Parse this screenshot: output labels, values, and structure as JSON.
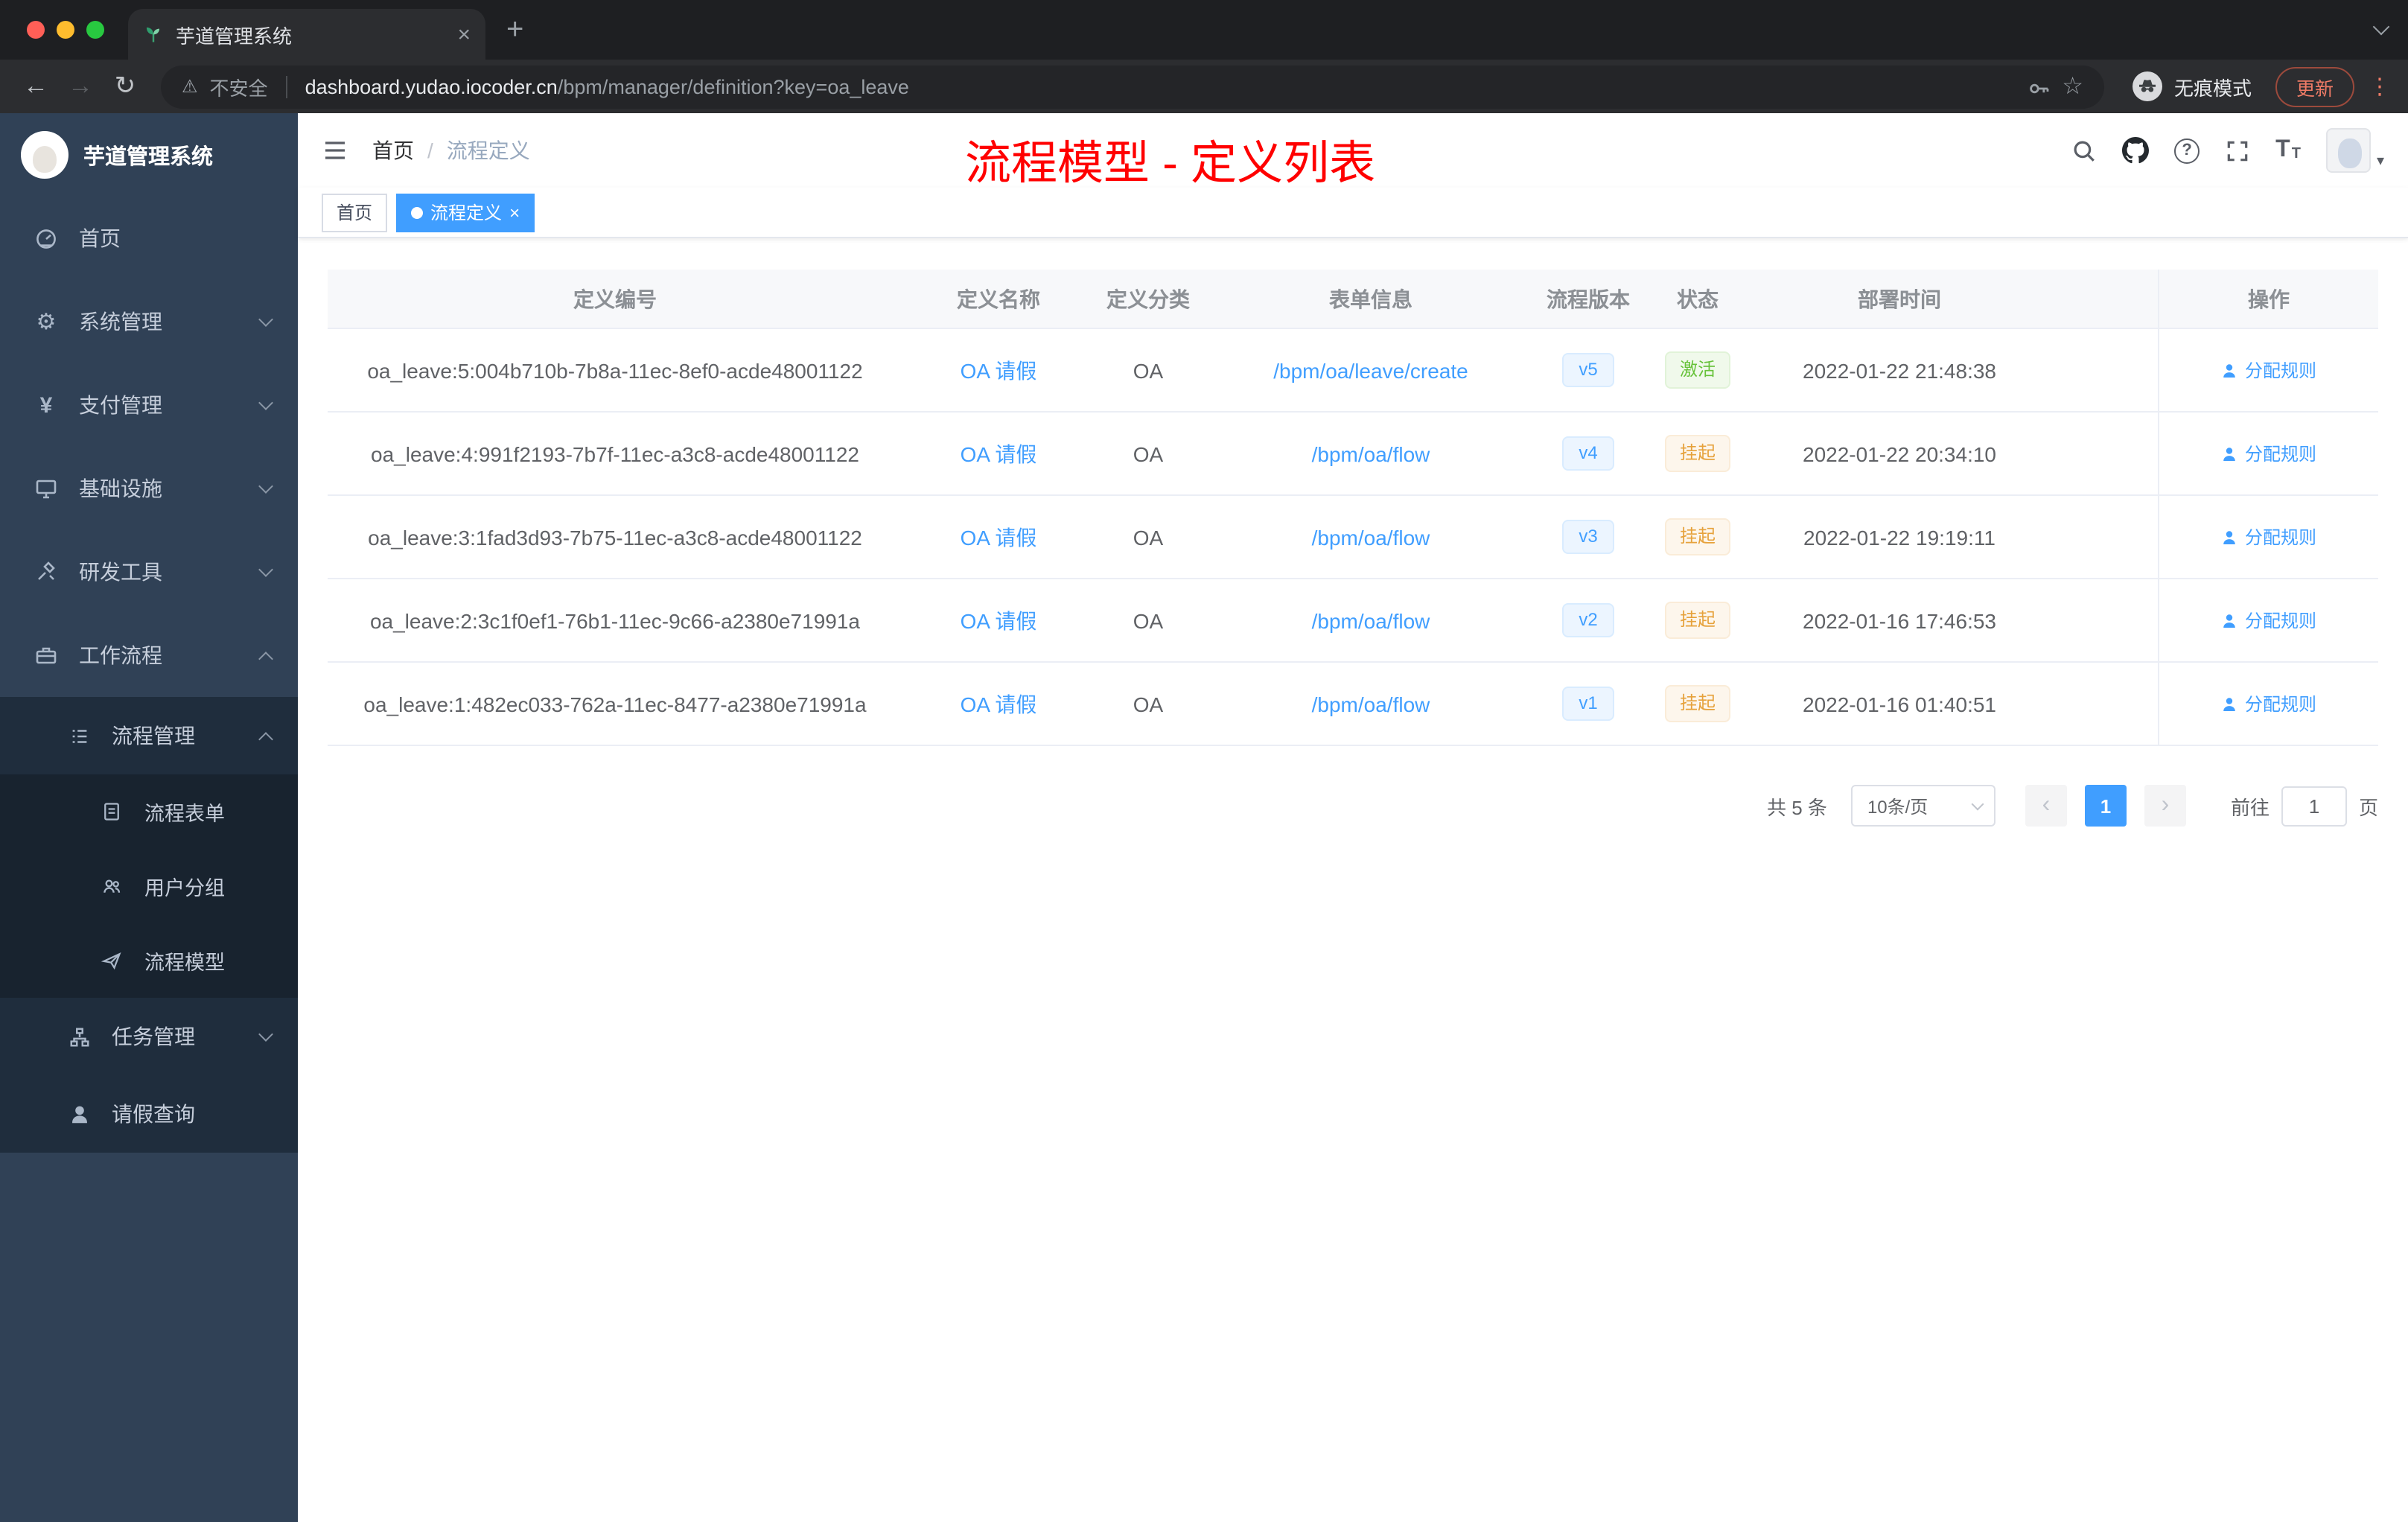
{
  "browser": {
    "tab_title": "芋道管理系统",
    "security_label": "不安全",
    "url_host": "dashboard.yudao.iocoder.cn",
    "url_path": "/bpm/manager/definition?key=oa_leave",
    "incognito_label": "无痕模式",
    "update_label": "更新"
  },
  "icons": {
    "close": "×",
    "plus": "+",
    "back": "←",
    "forward": "→",
    "reload": "↻",
    "warning": "⚠",
    "star": "☆",
    "kebab": "⋮",
    "caret_down": "▾",
    "gear": "⚙",
    "yen": "¥",
    "question": "?",
    "font_large": "T",
    "font_small": "T"
  },
  "sidebar": {
    "logo_title": "芋道管理系统",
    "items": [
      {
        "label": "首页"
      },
      {
        "label": "系统管理"
      },
      {
        "label": "支付管理"
      },
      {
        "label": "基础设施"
      },
      {
        "label": "研发工具"
      },
      {
        "label": "工作流程"
      },
      {
        "label": "流程管理"
      },
      {
        "label": "流程表单"
      },
      {
        "label": "用户分组"
      },
      {
        "label": "流程模型"
      },
      {
        "label": "任务管理"
      },
      {
        "label": "请假查询"
      }
    ]
  },
  "header": {
    "breadcrumb_home": "首页",
    "breadcrumb_separator": "/",
    "breadcrumb_current": "流程定义",
    "annotation": "流程模型 - 定义列表"
  },
  "tags": {
    "home": "首页",
    "active": "流程定义"
  },
  "table": {
    "columns": [
      "定义编号",
      "定义名称",
      "定义分类",
      "表单信息",
      "流程版本",
      "状态",
      "部署时间",
      "操作"
    ],
    "rows": [
      {
        "id": "oa_leave:5:004b710b-7b8a-11ec-8ef0-acde48001122",
        "name": "OA 请假",
        "category": "OA",
        "form": "/bpm/oa/leave/create",
        "version": "v5",
        "status": "激活",
        "deploy_time": "2022-01-22 21:48:38",
        "action": "分配规则"
      },
      {
        "id": "oa_leave:4:991f2193-7b7f-11ec-a3c8-acde48001122",
        "name": "OA 请假",
        "category": "OA",
        "form": "/bpm/oa/flow",
        "version": "v4",
        "status": "挂起",
        "deploy_time": "2022-01-22 20:34:10",
        "action": "分配规则"
      },
      {
        "id": "oa_leave:3:1fad3d93-7b75-11ec-a3c8-acde48001122",
        "name": "OA 请假",
        "category": "OA",
        "form": "/bpm/oa/flow",
        "version": "v3",
        "status": "挂起",
        "deploy_time": "2022-01-22 19:19:11",
        "action": "分配规则"
      },
      {
        "id": "oa_leave:2:3c1f0ef1-76b1-11ec-9c66-a2380e71991a",
        "name": "OA 请假",
        "category": "OA",
        "form": "/bpm/oa/flow",
        "version": "v2",
        "status": "挂起",
        "deploy_time": "2022-01-16 17:46:53",
        "action": "分配规则"
      },
      {
        "id": "oa_leave:1:482ec033-762a-11ec-8477-a2380e71991a",
        "name": "OA 请假",
        "category": "OA",
        "form": "/bpm/oa/flow",
        "version": "v1",
        "status": "挂起",
        "deploy_time": "2022-01-16 01:40:51",
        "action": "分配规则"
      }
    ]
  },
  "pagination": {
    "total": "共 5 条",
    "page_size": "10条/页",
    "prev": "‹",
    "next": "›",
    "current_page": "1",
    "goto_label": "前往",
    "goto_value": "1",
    "unit_label": "页"
  },
  "colors": {
    "accent": "#409eff",
    "success": "#67c23a",
    "warning": "#e6a23c",
    "annotation_red": "#ff0000",
    "sidebar_bg": "#304156",
    "submenu_bg": "#1f2d3d",
    "traffic_red": "#ff5f57",
    "traffic_yellow": "#febc2e",
    "traffic_green": "#28c840"
  }
}
